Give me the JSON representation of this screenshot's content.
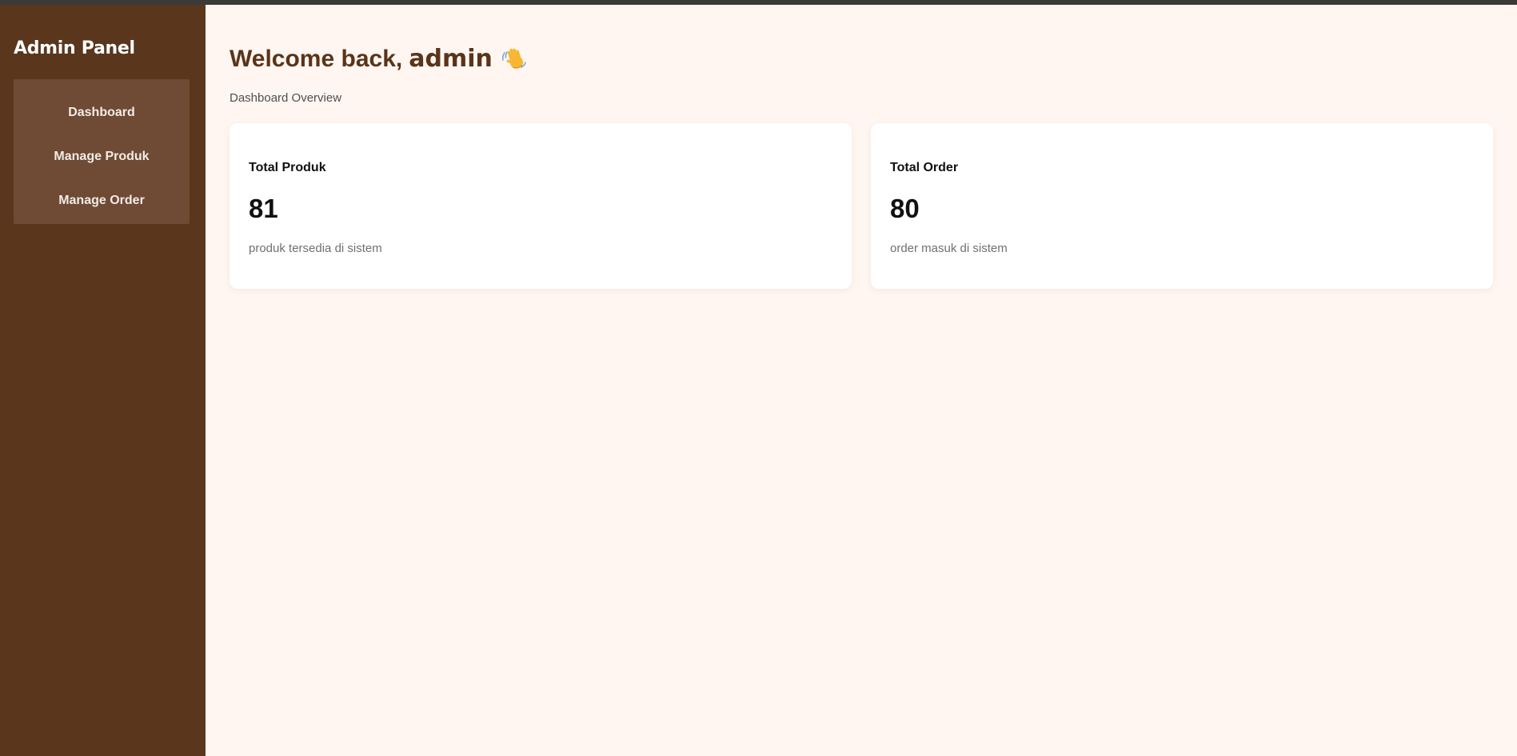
{
  "sidebar": {
    "brand": "Admin Panel",
    "items": [
      {
        "label": "Dashboard"
      },
      {
        "label": "Manage Produk"
      },
      {
        "label": "Manage Order"
      }
    ]
  },
  "header": {
    "welcome_prefix": "Welcome back,",
    "username": "admin",
    "wave_icon": "waving-hand-icon",
    "subtitle": "Dashboard Overview"
  },
  "stats": [
    {
      "label": "Total Produk",
      "value": "81",
      "description": "produk tersedia di sistem"
    },
    {
      "label": "Total Order",
      "value": "80",
      "description": "order masuk di sistem"
    }
  ],
  "colors": {
    "sidebar_bg": "#5a361d",
    "nav_bg": "#6f4a34",
    "page_bg": "#fff6f1",
    "heading": "#5a3419"
  }
}
